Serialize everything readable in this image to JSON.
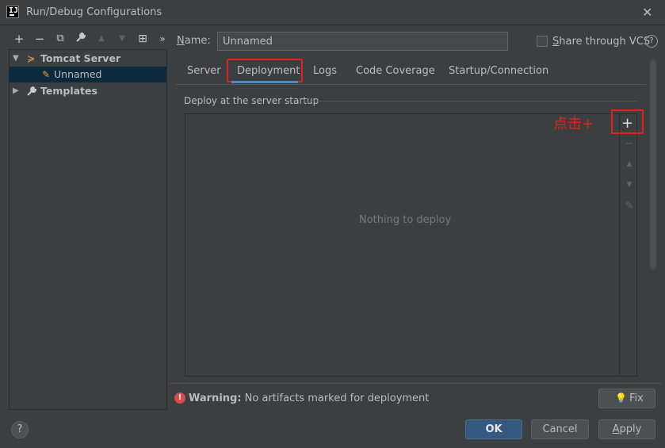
{
  "window": {
    "title": "Run/Debug Configurations",
    "close": "✕"
  },
  "toolbar": {
    "add": "+",
    "remove": "−",
    "copy": "⧉",
    "edit": "🔧",
    "up": "▲",
    "down": "▼",
    "folder": "⊞",
    "more": "»"
  },
  "tree": {
    "items": [
      {
        "label": "Tomcat Server",
        "icon": "tomcat-icon"
      },
      {
        "label": "Unnamed",
        "icon": "tomcat-config-icon"
      },
      {
        "label": "Templates",
        "icon": "wrench-icon"
      }
    ]
  },
  "form": {
    "name_label_prefix": "N",
    "name_label_rest": "ame:",
    "name_value": "Unnamed",
    "share_prefix": "S",
    "share_rest": "hare through VCS",
    "help": "?"
  },
  "tabs": [
    "Server",
    "Deployment",
    "Logs",
    "Code Coverage",
    "Startup/Connection"
  ],
  "active_tab": "Deployment",
  "deployment": {
    "section_title": "Deploy at the server startup",
    "empty_text": "Nothing to deploy",
    "annotation": "点击+",
    "add": "+",
    "remove": "−",
    "move_up": "▲",
    "move_down": "▼",
    "edit": "✎"
  },
  "warning": {
    "icon": "!",
    "bold": "Warning:",
    "text": "No artifacts marked for deployment",
    "fix_label": "Fix"
  },
  "footer": {
    "help": "?",
    "ok": "OK",
    "cancel": "Cancel",
    "apply_prefix": "A",
    "apply_rest": "pply"
  },
  "colors": {
    "accent": "#365880",
    "highlight_box": "#e2231a",
    "background": "#3c3f41"
  }
}
